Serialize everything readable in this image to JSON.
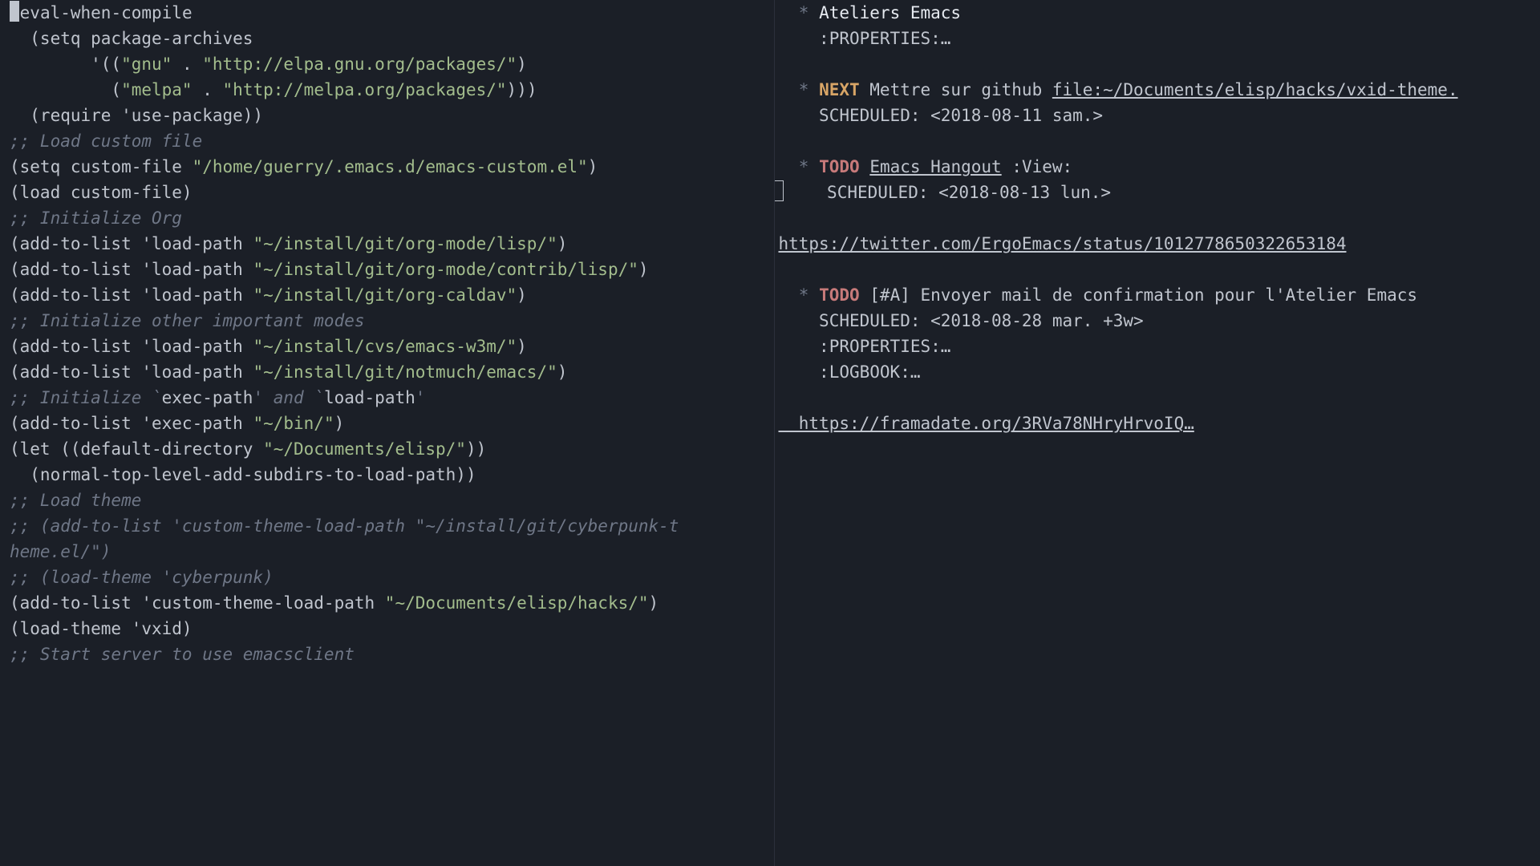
{
  "left": {
    "l01a": "(",
    "l01b": "eval-when-compile",
    "l02": "  (setq package-archives",
    "l03a": "        '((",
    "l03b": "\"gnu\"",
    "l03c": " . ",
    "l03d": "\"http://elpa.gnu.org/packages/\"",
    "l03e": ")",
    "l04a": "          (",
    "l04b": "\"melpa\"",
    "l04c": " . ",
    "l04d": "\"http://melpa.org/packages/\"",
    "l04e": ")))",
    "l05": "  (require 'use-package))",
    "l06": "",
    "l07": ";; Load custom file",
    "l08a": "(setq custom-file ",
    "l08b": "\"/home/guerry/.emacs.d/emacs-custom.el\"",
    "l08c": ")",
    "l09": "(load custom-file)",
    "l10": "",
    "l11": ";; Initialize Org",
    "l12a": "(add-to-list 'load-path ",
    "l12b": "\"~/install/git/org-mode/lisp/\"",
    "l12c": ")",
    "l13a": "(add-to-list 'load-path ",
    "l13b": "\"~/install/git/org-mode/contrib/lisp/\"",
    "l13c": ")",
    "l14a": "(add-to-list 'load-path ",
    "l14b": "\"~/install/git/org-caldav\"",
    "l14c": ")",
    "l15": "",
    "l16": ";; Initialize other important modes",
    "l17a": "(add-to-list 'load-path ",
    "l17b": "\"~/install/cvs/emacs-w3m/\"",
    "l17c": ")",
    "l18a": "(add-to-list 'load-path ",
    "l18b": "\"~/install/git/notmuch/emacs/\"",
    "l18c": ")",
    "l19": "",
    "l20a": ";; Initialize `",
    "l20b": "exec-path",
    "l20c": "' and `",
    "l20d": "load-path",
    "l20e": "'",
    "l21a": "(add-to-list 'exec-path ",
    "l21b": "\"~/bin/\"",
    "l21c": ")",
    "l22a": "(let ((default-directory ",
    "l22b": "\"~/Documents/elisp/\"",
    "l22c": "))",
    "l23": "  (normal-top-level-add-subdirs-to-load-path))",
    "l24": "",
    "l25": ";; Load theme",
    "l26": ";; (add-to-list 'custom-theme-load-path \"~/install/git/cyberpunk-t",
    "l27": "heme.el/\")",
    "l28": ";; (load-theme 'cyberpunk)",
    "l29a": "(add-to-list 'custom-theme-load-path ",
    "l29b": "\"~/Documents/elisp/hacks/\"",
    "l29c": ")",
    "l30": "(load-theme 'vxid)",
    "l31": "",
    "l32": ";; Start server to use emacsclient"
  },
  "right": {
    "h1_bullet": "  * ",
    "h1_title": "Ateliers Emacs",
    "h1_prop": "    :PROPERTIES:…",
    "h2_bullet": "  * ",
    "h2_kw": "NEXT",
    "h2_text": " Mettre sur github ",
    "h2_link": "file:~/Documents/elisp/hacks/vxid-theme.",
    "h2_sched": "    SCHEDULED: <2018-08-11 sam.>",
    "h3_pre": "  ",
    "h3_bullet": "* ",
    "h3_kw": "TODO",
    "h3_sp": " ",
    "h3_link": "Emacs Hangout",
    "h3_tag": " :View:",
    "h3_sched": "    SCHEDULED: <2018-08-13 lun.>",
    "url1": "https://twitter.com/ErgoEmacs/status/1012778650322653184",
    "h4_bullet": "  * ",
    "h4_kw": "TODO",
    "h4_prio": " [#A] ",
    "h4_text": "Envoyer mail de confirmation pour l'Atelier Emacs",
    "h4_sched": "    SCHEDULED: <2018-08-28 mar. +3w>",
    "h4_prop": "    :PROPERTIES:…",
    "h4_log": "    :LOGBOOK:…",
    "url2": "  https://framadate.org/3RVa78NHryHrvoIQ…"
  }
}
